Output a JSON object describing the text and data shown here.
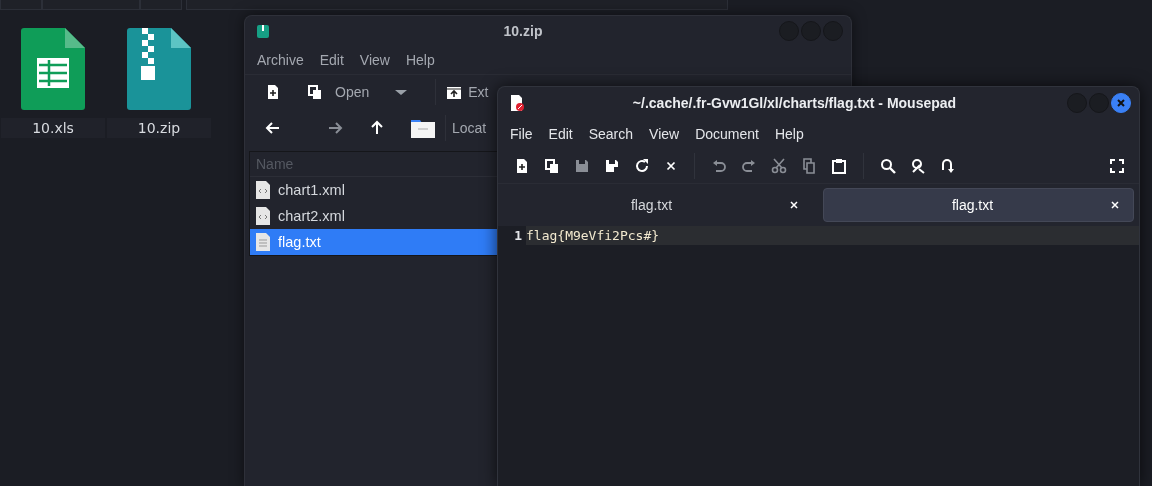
{
  "desktop_icons": [
    {
      "label": "10.xls",
      "kind": "spreadsheet"
    },
    {
      "label": "10.zip",
      "kind": "archive"
    }
  ],
  "archive_window": {
    "title": "10.zip",
    "menu": [
      "Archive",
      "Edit",
      "View",
      "Help"
    ],
    "open_label": "Open",
    "extract_label": "Ext",
    "location_label": "Locat",
    "column": "Name",
    "files": [
      {
        "name": "chart1.xml",
        "kind": "xml",
        "selected": false
      },
      {
        "name": "chart2.xml",
        "kind": "xml",
        "selected": false
      },
      {
        "name": "flag.txt",
        "kind": "text",
        "selected": true
      }
    ]
  },
  "editor_window": {
    "title": "~/.cache/.fr-Gvw1Gl/xl/charts/flag.txt - Mousepad",
    "menu": [
      "File",
      "Edit",
      "Search",
      "View",
      "Document",
      "Help"
    ],
    "tabs": [
      {
        "label": "flag.txt",
        "selected": false
      },
      {
        "label": "flag.txt",
        "selected": true
      }
    ],
    "lines": [
      {
        "number": "1",
        "text": "flag{M9eVfi2Pcs#}"
      }
    ]
  }
}
